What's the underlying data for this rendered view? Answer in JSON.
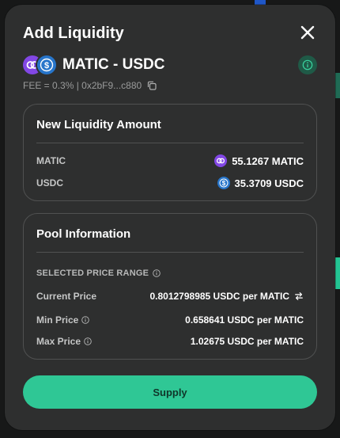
{
  "modal": {
    "title": "Add Liquidity"
  },
  "pair": {
    "name": "MATIC - USDC",
    "fee_text": "FEE = 0.3% | 0x2bF9...c880"
  },
  "new_liquidity": {
    "title": "New Liquidity Amount",
    "rows": [
      {
        "label": "MATIC",
        "value": "55.1267 MATIC",
        "icon": "matic-token-icon"
      },
      {
        "label": "USDC",
        "value": "35.3709 USDC",
        "icon": "usdc-token-icon"
      }
    ]
  },
  "pool_info": {
    "title": "Pool Information",
    "selected_range_label": "SELECTED PRICE RANGE",
    "current_price_label": "Current Price",
    "current_price_value": "0.8012798985 USDC per MATIC",
    "min_price_label": "Min Price",
    "min_price_value": "0.658641 USDC per MATIC",
    "max_price_label": "Max Price",
    "max_price_value": "1.02675 USDC per MATIC"
  },
  "actions": {
    "supply_label": "Supply"
  },
  "colors": {
    "accent": "#2fc795",
    "modal_bg": "#2e2f2f",
    "matic": "#8247e5",
    "usdc": "#2775ca"
  }
}
